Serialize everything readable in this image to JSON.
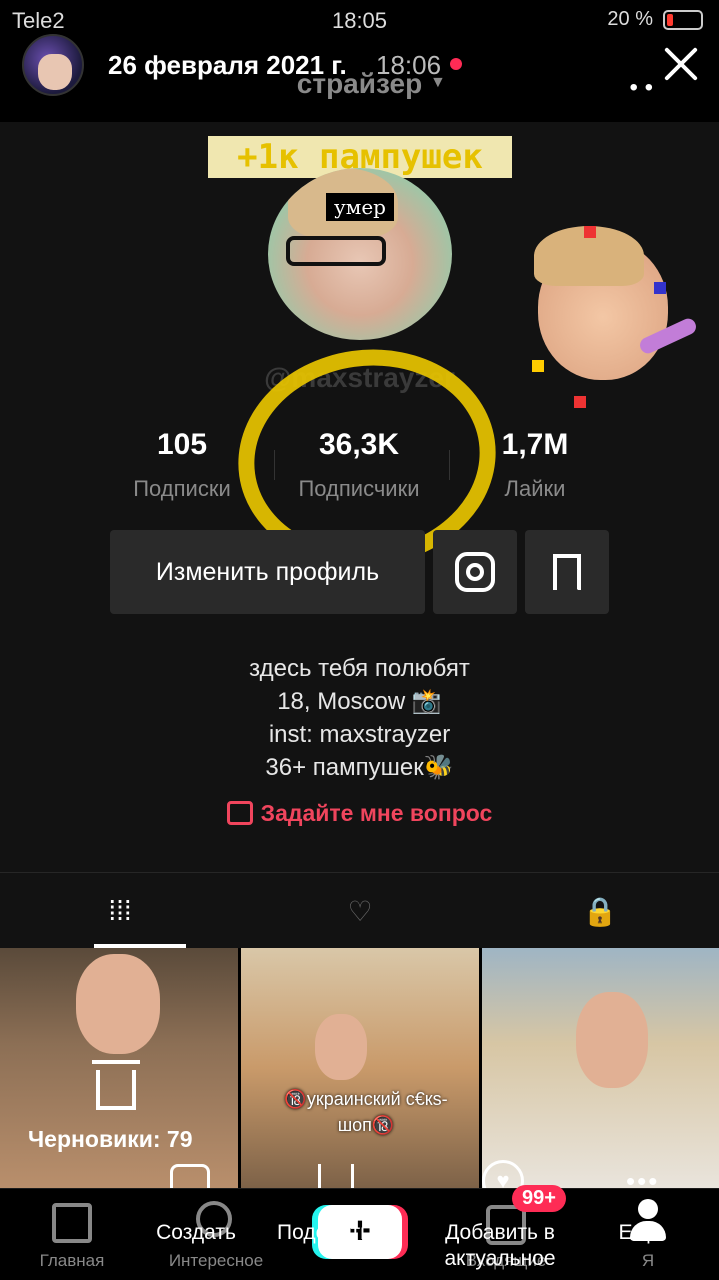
{
  "status_bar": {
    "carrier": "Tele2",
    "time": "18:05",
    "battery": "20 %",
    "battery_color": "#ff3b30"
  },
  "story": {
    "date": "26 февраля 2021 г.",
    "time": "18:06",
    "close_icon": "close-icon"
  },
  "profile": {
    "username": "страйзер",
    "sticker_text": "+1к пампушек",
    "photo_caption": "умер",
    "handle": "@maxstrayzer",
    "stats": [
      {
        "value": "105",
        "label": "Подписки"
      },
      {
        "value": "36,3K",
        "label": "Подписчики"
      },
      {
        "value": "1,7M",
        "label": "Лайки"
      }
    ],
    "edit_button": "Изменить профиль",
    "bio": [
      "здесь тебя полюбят",
      "18, Moscow 📸",
      "inst: maxstrayzer",
      "36+ пампушек🐝"
    ],
    "ask_link": "Задайте мне вопрос",
    "accent_color": "#f0455d",
    "highlight_color": "#e8c400"
  },
  "tabs": [
    {
      "icon": "grid-icon",
      "glyph": "⁞⁞⁞"
    },
    {
      "icon": "liked-hidden-icon",
      "glyph": "♡"
    },
    {
      "icon": "lock-icon",
      "glyph": "🔒"
    }
  ],
  "grid": {
    "drafts_label": "Черновики: 79",
    "video2_caption": "🔞украинский с€кs-шоп🔞"
  },
  "story_actions": {
    "create": "Создать",
    "share": "Поделиться",
    "highlight": "Добавить в актуальное",
    "more": "Ещё"
  },
  "bottom_nav": {
    "home": "Главная",
    "discover": "Интересное",
    "plus": "+",
    "inbox": "Входящие",
    "inbox_badge": "99+",
    "me": "Я"
  }
}
